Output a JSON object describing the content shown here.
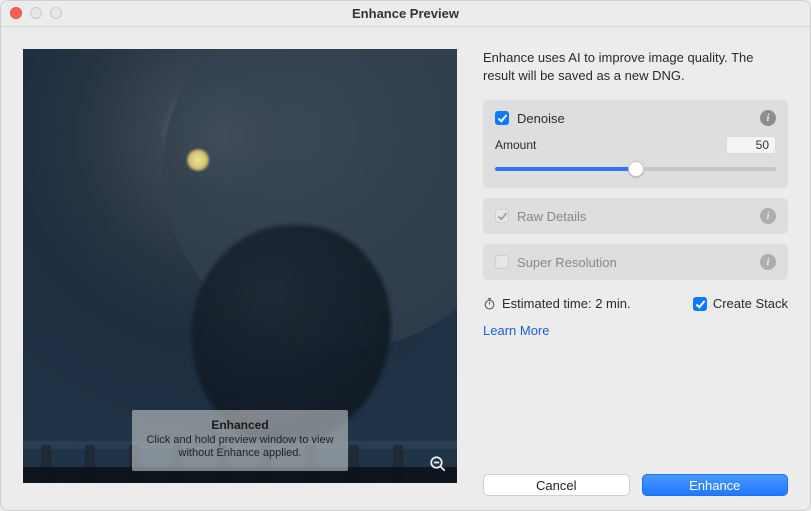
{
  "window": {
    "title": "Enhance Preview"
  },
  "preview": {
    "tooltip_title": "Enhanced",
    "tooltip_line1": "Click and hold preview window to view",
    "tooltip_line2": "without Enhance applied."
  },
  "controls": {
    "description": "Enhance uses AI to improve image quality. The result will be saved as a new DNG.",
    "denoise": {
      "label": "Denoise",
      "checked": true,
      "amount_label": "Amount",
      "amount_value": "50",
      "amount_percent": 50
    },
    "raw_details": {
      "label": "Raw Details",
      "checked": true,
      "enabled": false
    },
    "super_resolution": {
      "label": "Super Resolution",
      "checked": false,
      "enabled": false
    },
    "estimated": "Estimated time: 2 min.",
    "create_stack": {
      "label": "Create Stack",
      "checked": true
    },
    "learn_more": "Learn More"
  },
  "buttons": {
    "cancel": "Cancel",
    "enhance": "Enhance"
  }
}
